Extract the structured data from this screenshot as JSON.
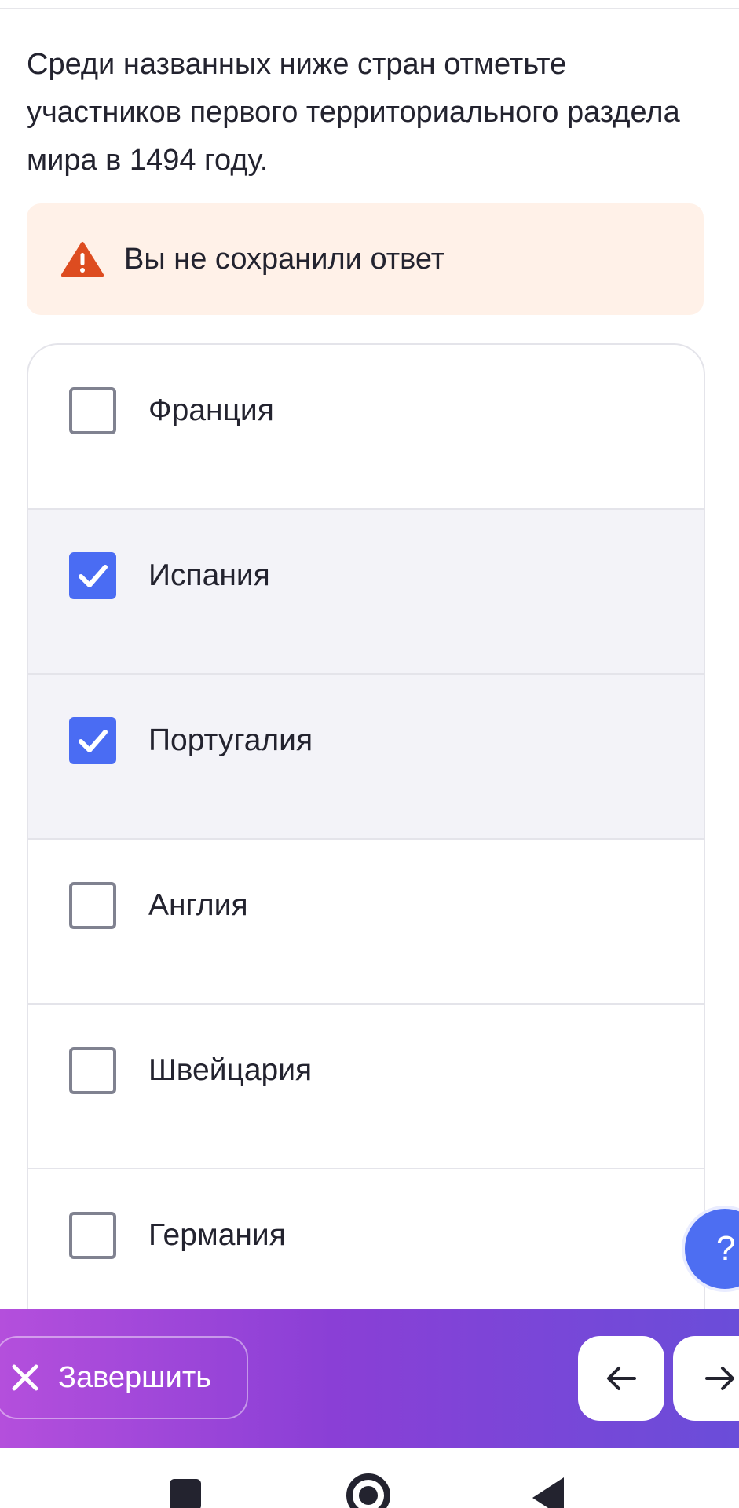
{
  "question": {
    "text": "Среди названных ниже стран отметьте участников первого территориального раздела мира в 1494 году."
  },
  "warning": {
    "text": "Вы не сохранили ответ",
    "icon": "warning-triangle-icon",
    "color": "#dd4c20"
  },
  "options": [
    {
      "label": "Франция",
      "checked": false
    },
    {
      "label": "Испания",
      "checked": true
    },
    {
      "label": "Португалия",
      "checked": true
    },
    {
      "label": "Англия",
      "checked": false
    },
    {
      "label": "Швейцария",
      "checked": false
    },
    {
      "label": "Германия",
      "checked": false
    }
  ],
  "help": {
    "label": "?"
  },
  "bottom_bar": {
    "finish_label": "Завершить",
    "prev_icon": "arrow-left-icon",
    "next_icon": "arrow-right-icon"
  },
  "colors": {
    "accent": "#4a6cf3",
    "warning_bg": "#fff1e8",
    "bar_gradient_start": "#b44fdc",
    "bar_gradient_end": "#6a4dd9"
  }
}
